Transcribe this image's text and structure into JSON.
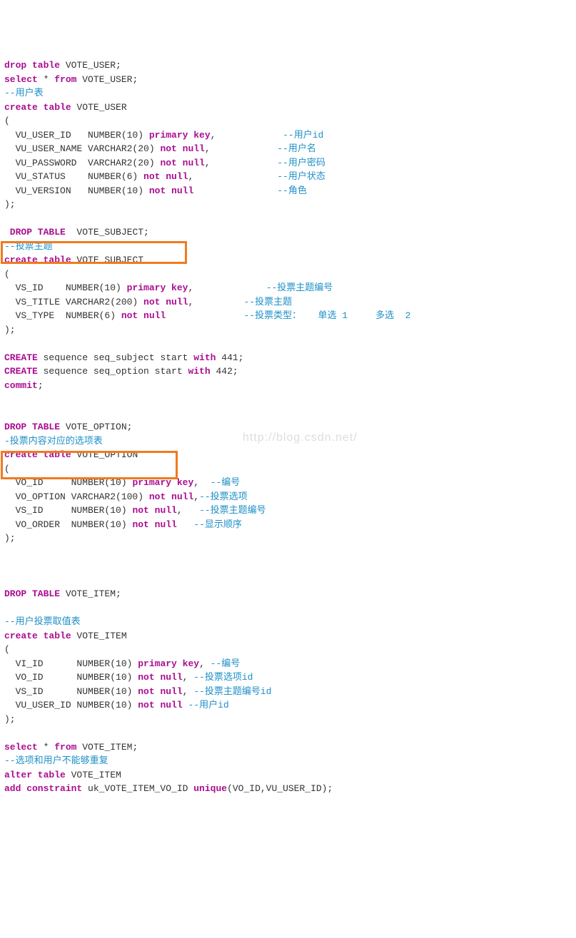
{
  "watermark": "http://blog.csdn.net/",
  "lines": [
    [
      [
        "kw",
        "drop table"
      ],
      [
        "plain",
        " VOTE_USER;"
      ]
    ],
    [
      [
        "kw",
        "select"
      ],
      [
        "plain",
        " * "
      ],
      [
        "kw",
        "from"
      ],
      [
        "plain",
        " VOTE_USER;"
      ]
    ],
    [
      [
        "cm",
        "--用户表"
      ]
    ],
    [
      [
        "kw",
        "create table"
      ],
      [
        "plain",
        " VOTE_USER"
      ]
    ],
    [
      [
        "plain",
        "("
      ]
    ],
    [
      [
        "plain",
        "  VU_USER_ID   NUMBER(10) "
      ],
      [
        "kw",
        "primary key"
      ],
      [
        "plain",
        ",            "
      ],
      [
        "cm",
        "--用户id"
      ]
    ],
    [
      [
        "plain",
        "  VU_USER_NAME VARCHAR2(20) "
      ],
      [
        "kw",
        "not null"
      ],
      [
        "plain",
        ",            "
      ],
      [
        "cm",
        "--用户名"
      ]
    ],
    [
      [
        "plain",
        "  VU_PASSWORD  VARCHAR2(20) "
      ],
      [
        "kw",
        "not null"
      ],
      [
        "plain",
        ",            "
      ],
      [
        "cm",
        "--用户密码"
      ]
    ],
    [
      [
        "plain",
        "  VU_STATUS    NUMBER(6) "
      ],
      [
        "kw",
        "not null"
      ],
      [
        "plain",
        ",               "
      ],
      [
        "cm",
        "--用户状态"
      ]
    ],
    [
      [
        "plain",
        "  VU_VERSION   NUMBER(10) "
      ],
      [
        "kw",
        "not null"
      ],
      [
        "plain",
        "               "
      ],
      [
        "cm",
        "--角色"
      ]
    ],
    [
      [
        "plain",
        ");"
      ]
    ],
    [
      [
        "plain",
        ""
      ]
    ],
    [
      [
        "kw",
        " DROP TABLE"
      ],
      [
        "plain",
        "  VOTE_SUBJECT;"
      ]
    ],
    [
      [
        "cm",
        "--投票主题"
      ]
    ],
    [
      [
        "kw",
        "create table"
      ],
      [
        "plain",
        " VOTE_SUBJECT"
      ]
    ],
    [
      [
        "plain",
        "("
      ]
    ],
    [
      [
        "plain",
        "  VS_ID    NUMBER(10) "
      ],
      [
        "kw",
        "primary key"
      ],
      [
        "plain",
        ",             "
      ],
      [
        "cm",
        "--投票主题编号"
      ]
    ],
    [
      [
        "plain",
        "  VS_TITLE VARCHAR2(200) "
      ],
      [
        "kw",
        "not null"
      ],
      [
        "plain",
        ",         "
      ],
      [
        "cm",
        "--投票主题"
      ]
    ],
    [
      [
        "plain",
        "  VS_TYPE  NUMBER(6) "
      ],
      [
        "kw",
        "not null"
      ],
      [
        "plain",
        "              "
      ],
      [
        "cm",
        "--投票类型：   单选 1     多选  2"
      ]
    ],
    [
      [
        "plain",
        ");"
      ]
    ],
    [
      [
        "plain",
        ""
      ]
    ],
    [
      [
        "kw",
        "CREATE"
      ],
      [
        "plain",
        " sequence seq_subject start "
      ],
      [
        "kw",
        "with"
      ],
      [
        "plain",
        " 441;"
      ]
    ],
    [
      [
        "kw",
        "CREATE"
      ],
      [
        "plain",
        " sequence seq_option start "
      ],
      [
        "kw",
        "with"
      ],
      [
        "plain",
        " 442;"
      ]
    ],
    [
      [
        "kw",
        "commit"
      ],
      [
        "plain",
        ";"
      ]
    ],
    [
      [
        "plain",
        ""
      ]
    ],
    [
      [
        "plain",
        ""
      ]
    ],
    [
      [
        "kw",
        "DROP TABLE"
      ],
      [
        "plain",
        " VOTE_OPTION;"
      ]
    ],
    [
      [
        "cm",
        "-投票内容对应的选项表"
      ]
    ],
    [
      [
        "kw",
        "create table"
      ],
      [
        "plain",
        " VOTE_OPTION"
      ]
    ],
    [
      [
        "plain",
        "("
      ]
    ],
    [
      [
        "plain",
        "  VO_ID     NUMBER(10) "
      ],
      [
        "kw",
        "primary key"
      ],
      [
        "plain",
        ",  "
      ],
      [
        "cm",
        "--编号"
      ]
    ],
    [
      [
        "plain",
        "  VO_OPTION VARCHAR2(100) "
      ],
      [
        "kw",
        "not null"
      ],
      [
        "plain",
        ","
      ],
      [
        "cm",
        "--投票选项"
      ]
    ],
    [
      [
        "plain",
        "  VS_ID     NUMBER(10) "
      ],
      [
        "kw",
        "not null"
      ],
      [
        "plain",
        ",   "
      ],
      [
        "cm",
        "--投票主题编号"
      ]
    ],
    [
      [
        "plain",
        "  VO_ORDER  NUMBER(10) "
      ],
      [
        "kw",
        "not null"
      ],
      [
        "plain",
        "   "
      ],
      [
        "cm",
        "--显示顺序"
      ]
    ],
    [
      [
        "plain",
        ");"
      ]
    ],
    [
      [
        "plain",
        ""
      ]
    ],
    [
      [
        "plain",
        ""
      ]
    ],
    [
      [
        "plain",
        ""
      ]
    ],
    [
      [
        "kw",
        "DROP TABLE"
      ],
      [
        "plain",
        " VOTE_ITEM;"
      ]
    ],
    [
      [
        "plain",
        ""
      ]
    ],
    [
      [
        "cm",
        "--用户投票取值表"
      ]
    ],
    [
      [
        "kw",
        "create table"
      ],
      [
        "plain",
        " VOTE_ITEM"
      ]
    ],
    [
      [
        "plain",
        "("
      ]
    ],
    [
      [
        "plain",
        "  VI_ID      NUMBER(10) "
      ],
      [
        "kw",
        "primary key"
      ],
      [
        "plain",
        ", "
      ],
      [
        "cm",
        "--编号"
      ]
    ],
    [
      [
        "plain",
        "  VO_ID      NUMBER(10) "
      ],
      [
        "kw",
        "not null"
      ],
      [
        "plain",
        ", "
      ],
      [
        "cm",
        "--投票选项id"
      ]
    ],
    [
      [
        "plain",
        "  VS_ID      NUMBER(10) "
      ],
      [
        "kw",
        "not null"
      ],
      [
        "plain",
        ", "
      ],
      [
        "cm",
        "--投票主题编号id"
      ]
    ],
    [
      [
        "plain",
        "  VU_USER_ID NUMBER(10) "
      ],
      [
        "kw",
        "not null"
      ],
      [
        "plain",
        " "
      ],
      [
        "cm",
        "--用户id"
      ]
    ],
    [
      [
        "plain",
        ");"
      ]
    ],
    [
      [
        "plain",
        ""
      ]
    ],
    [
      [
        "kw",
        "select"
      ],
      [
        "plain",
        " * "
      ],
      [
        "kw",
        "from"
      ],
      [
        "plain",
        " VOTE_ITEM;"
      ]
    ],
    [
      [
        "cm",
        "--选项和用户不能够重复"
      ]
    ],
    [
      [
        "kw",
        "alter table"
      ],
      [
        "plain",
        " VOTE_ITEM"
      ]
    ],
    [
      [
        "kw",
        "add constraint"
      ],
      [
        "plain",
        " uk_VOTE_ITEM_VO_ID "
      ],
      [
        "kw",
        "unique"
      ],
      [
        "plain",
        "(VO_ID,VU_USER_ID);"
      ]
    ]
  ]
}
